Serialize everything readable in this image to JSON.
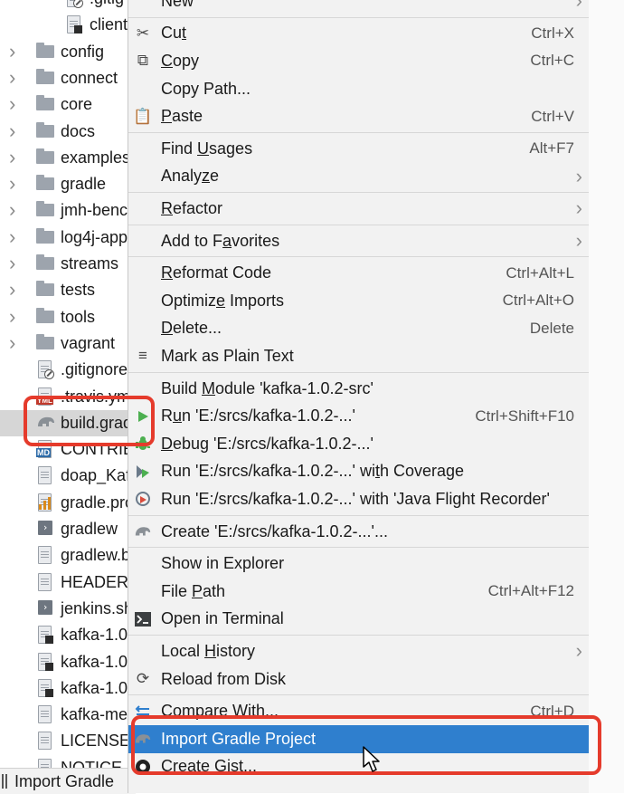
{
  "tree": {
    "items": [
      {
        "label": ".gitig",
        "kind": "file-circle",
        "indent": 2,
        "arrow": false
      },
      {
        "label": "client",
        "kind": "file-dark",
        "indent": 2,
        "arrow": false
      },
      {
        "label": "config",
        "kind": "folder",
        "indent": 1,
        "arrow": true
      },
      {
        "label": "connect",
        "kind": "folder",
        "indent": 1,
        "arrow": true
      },
      {
        "label": "core",
        "kind": "folder",
        "indent": 1,
        "arrow": true
      },
      {
        "label": "docs",
        "kind": "folder",
        "indent": 1,
        "arrow": true
      },
      {
        "label": "examples",
        "kind": "folder",
        "indent": 1,
        "arrow": true
      },
      {
        "label": "gradle",
        "kind": "folder",
        "indent": 1,
        "arrow": true
      },
      {
        "label": "jmh-benc",
        "kind": "folder",
        "indent": 1,
        "arrow": true
      },
      {
        "label": "log4j-app",
        "kind": "folder",
        "indent": 1,
        "arrow": true
      },
      {
        "label": "streams",
        "kind": "folder",
        "indent": 1,
        "arrow": true
      },
      {
        "label": "tests",
        "kind": "folder",
        "indent": 1,
        "arrow": true
      },
      {
        "label": "tools",
        "kind": "folder",
        "indent": 1,
        "arrow": true
      },
      {
        "label": "vagrant",
        "kind": "folder",
        "indent": 1,
        "arrow": true
      },
      {
        "label": ".gitignore",
        "kind": "file-circle",
        "indent": 1,
        "arrow": false
      },
      {
        "label": ".travis.yml",
        "kind": "yml",
        "indent": 1,
        "arrow": false
      },
      {
        "label": "build.gradle",
        "kind": "gradle",
        "indent": 1,
        "arrow": false,
        "selected": true
      },
      {
        "label": "CONTRIBUTING",
        "kind": "md",
        "indent": 1,
        "arrow": false
      },
      {
        "label": "doap_Kafka",
        "kind": "file",
        "indent": 1,
        "arrow": false
      },
      {
        "label": "gradle.properties",
        "kind": "bars",
        "indent": 1,
        "arrow": false
      },
      {
        "label": "gradlew",
        "kind": "term",
        "indent": 1,
        "arrow": false
      },
      {
        "label": "gradlew.bat",
        "kind": "file",
        "indent": 1,
        "arrow": false
      },
      {
        "label": "HEADER",
        "kind": "file",
        "indent": 1,
        "arrow": false
      },
      {
        "label": "jenkins.sh",
        "kind": "term",
        "indent": 1,
        "arrow": false
      },
      {
        "label": "kafka-1.0",
        "kind": "file-dark",
        "indent": 1,
        "arrow": false
      },
      {
        "label": "kafka-1.0",
        "kind": "file-dark",
        "indent": 1,
        "arrow": false
      },
      {
        "label": "kafka-1.0",
        "kind": "file-dark",
        "indent": 1,
        "arrow": false
      },
      {
        "label": "kafka-merge",
        "kind": "file",
        "indent": 1,
        "arrow": false
      },
      {
        "label": "LICENSE",
        "kind": "file",
        "indent": 1,
        "arrow": false
      },
      {
        "label": "NOTICE",
        "kind": "file",
        "indent": 1,
        "arrow": false
      }
    ]
  },
  "status": {
    "label": "Import Gradle"
  },
  "menu": {
    "items": [
      {
        "type": "item",
        "label": "New",
        "u": null,
        "shortcut": "",
        "submenu": true,
        "icon": ""
      },
      {
        "type": "sep"
      },
      {
        "type": "item",
        "label": "Cut",
        "u": 2,
        "shortcut": "Ctrl+X",
        "submenu": false,
        "icon": "scissors"
      },
      {
        "type": "item",
        "label": "Copy",
        "u": 0,
        "shortcut": "Ctrl+C",
        "submenu": false,
        "icon": "copy"
      },
      {
        "type": "item",
        "label": "Copy Path...",
        "u": null,
        "shortcut": "",
        "submenu": false,
        "icon": ""
      },
      {
        "type": "item",
        "label": "Paste",
        "u": 0,
        "shortcut": "Ctrl+V",
        "submenu": false,
        "icon": "paste"
      },
      {
        "type": "sep"
      },
      {
        "type": "item",
        "label": "Find Usages",
        "u": 5,
        "shortcut": "Alt+F7",
        "submenu": false,
        "icon": ""
      },
      {
        "type": "item",
        "label": "Analyze",
        "u": 5,
        "shortcut": "",
        "submenu": true,
        "icon": ""
      },
      {
        "type": "sep"
      },
      {
        "type": "item",
        "label": "Refactor",
        "u": 0,
        "shortcut": "",
        "submenu": true,
        "icon": ""
      },
      {
        "type": "sep"
      },
      {
        "type": "item",
        "label": "Add to Favorites",
        "u": 8,
        "shortcut": "",
        "submenu": true,
        "icon": ""
      },
      {
        "type": "sep"
      },
      {
        "type": "item",
        "label": "Reformat Code",
        "u": 0,
        "shortcut": "Ctrl+Alt+L",
        "submenu": false,
        "icon": ""
      },
      {
        "type": "item",
        "label": "Optimize Imports",
        "u": 7,
        "shortcut": "Ctrl+Alt+O",
        "submenu": false,
        "icon": ""
      },
      {
        "type": "item",
        "label": "Delete...",
        "u": 0,
        "shortcut": "Delete",
        "submenu": false,
        "icon": ""
      },
      {
        "type": "item",
        "label": "Mark as Plain Text",
        "u": null,
        "shortcut": "",
        "submenu": false,
        "icon": "plaintext"
      },
      {
        "type": "sep"
      },
      {
        "type": "item",
        "label": "Build Module 'kafka-1.0.2-src'",
        "u": 6,
        "shortcut": "",
        "submenu": false,
        "icon": ""
      },
      {
        "type": "item",
        "label": "Run 'E:/srcs/kafka-1.0.2-...'",
        "u": 1,
        "shortcut": "Ctrl+Shift+F10",
        "submenu": false,
        "icon": "run"
      },
      {
        "type": "item",
        "label": "Debug 'E:/srcs/kafka-1.0.2-...'",
        "u": 0,
        "shortcut": "",
        "submenu": false,
        "icon": "debug"
      },
      {
        "type": "item",
        "label": "Run 'E:/srcs/kafka-1.0.2-...' with Coverage",
        "u": 32,
        "shortcut": "",
        "submenu": false,
        "icon": "coverage"
      },
      {
        "type": "item",
        "label": "Run 'E:/srcs/kafka-1.0.2-...' with 'Java Flight Recorder'",
        "u": null,
        "shortcut": "",
        "submenu": false,
        "icon": "profiler"
      },
      {
        "type": "sep"
      },
      {
        "type": "item",
        "label": "Create 'E:/srcs/kafka-1.0.2-...'...",
        "u": null,
        "shortcut": "",
        "submenu": false,
        "icon": "gradle"
      },
      {
        "type": "sep"
      },
      {
        "type": "item",
        "label": "Show in Explorer",
        "u": null,
        "shortcut": "",
        "submenu": false,
        "icon": ""
      },
      {
        "type": "item",
        "label": "File Path",
        "u": 5,
        "shortcut": "Ctrl+Alt+F12",
        "submenu": false,
        "icon": ""
      },
      {
        "type": "item",
        "label": "Open in Terminal",
        "u": null,
        "shortcut": "",
        "submenu": false,
        "icon": "terminal"
      },
      {
        "type": "sep"
      },
      {
        "type": "item",
        "label": "Local History",
        "u": 6,
        "shortcut": "",
        "submenu": true,
        "icon": ""
      },
      {
        "type": "item",
        "label": "Reload from Disk",
        "u": null,
        "shortcut": "",
        "submenu": false,
        "icon": "reload"
      },
      {
        "type": "sep"
      },
      {
        "type": "item",
        "label": "Compare With...",
        "u": null,
        "shortcut": "Ctrl+D",
        "submenu": false,
        "icon": "compare"
      },
      {
        "type": "item",
        "label": "Import Gradle Project",
        "u": null,
        "shortcut": "",
        "submenu": false,
        "icon": "gradle",
        "active": true
      },
      {
        "type": "item",
        "label": "Create Gist...",
        "u": null,
        "shortcut": "",
        "submenu": false,
        "icon": "github"
      }
    ]
  },
  "colors": {
    "highlight": "#e53b2c",
    "active": "#2f7fce",
    "menu_bg": "#f2f2f2"
  }
}
